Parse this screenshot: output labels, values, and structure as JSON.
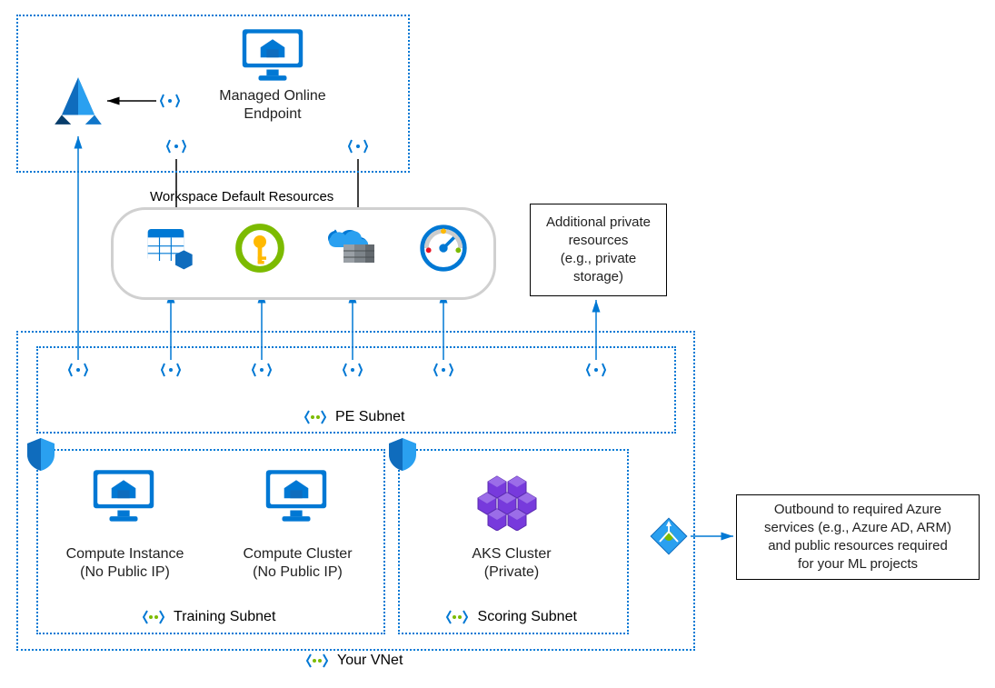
{
  "top_box": {
    "managed_endpoint_label": "Managed Online\nEndpoint"
  },
  "workspace_resources": {
    "title": "Workspace Default Resources"
  },
  "private_resources_box": "Additional private\nresources\n(e.g., private\nstorage)",
  "vnet": {
    "label": "Your VNet",
    "pe_subnet_label": "PE Subnet",
    "training_subnet_label": "Training Subnet",
    "scoring_subnet_label": "Scoring Subnet",
    "compute_instance_label": "Compute Instance\n(No Public IP)",
    "compute_cluster_label": "Compute Cluster\n(No Public IP)",
    "aks_label": "AKS Cluster\n(Private)"
  },
  "outbound_box": "Outbound to required Azure\nservices (e.g., Azure AD, ARM)\nand public resources required\nfor your ML projects",
  "icons": {
    "pe": "private-endpoint",
    "pe_green": "subnet",
    "ml_workspace": "aml-workspace",
    "monitor_vm": "monitor-vm",
    "storage": "storage",
    "keyvault": "key-vault",
    "acr": "container-registry",
    "appinsights": "app-insights",
    "shield": "shield",
    "aks": "aks-cluster",
    "loadbalancer": "load-balancer"
  }
}
